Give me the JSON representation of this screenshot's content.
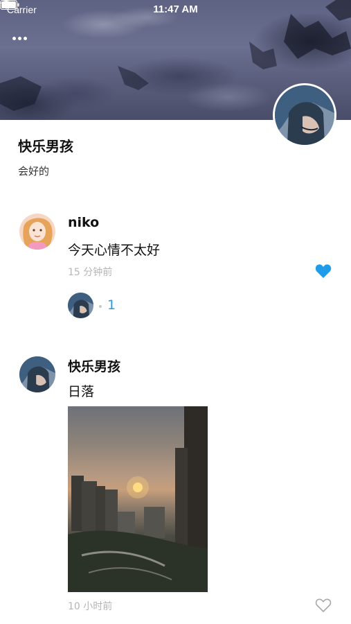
{
  "status_bar": {
    "carrier": "Carrier",
    "time": "11:47 AM"
  },
  "cover": {
    "more_icon": "ellipsis-icon"
  },
  "profile": {
    "name": "快乐男孩",
    "bio": "会好的"
  },
  "posts": [
    {
      "author": "niko",
      "text": "今天心情不太好",
      "time": "15 分钟前",
      "liked": true,
      "like_count": "1",
      "has_photo": false
    },
    {
      "author": "快乐男孩",
      "text": "日落",
      "time": "10 小时前",
      "liked": false,
      "has_photo": true
    }
  ],
  "colors": {
    "accent": "#1e9be9",
    "muted_text": "#b5b5b5"
  }
}
